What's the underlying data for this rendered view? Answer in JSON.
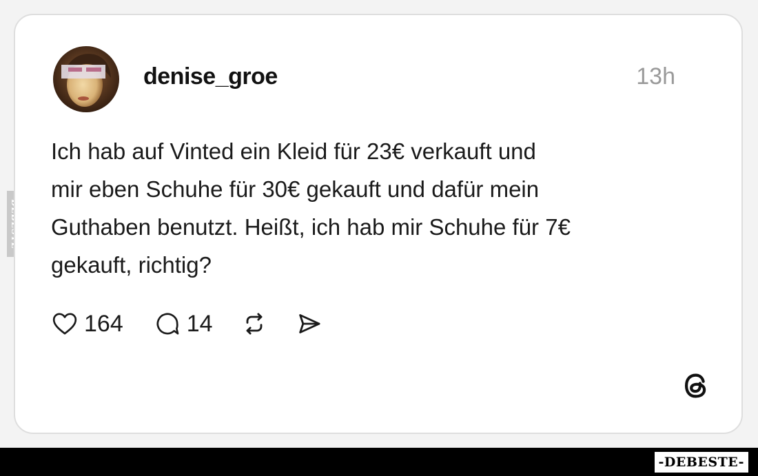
{
  "post": {
    "username": "denise_groe",
    "timestamp": "13h",
    "text_lines": [
      "Ich hab auf Vinted ein Kleid für 23€ verkauft und",
      "mir eben Schuhe für 30€ gekauft und dafür mein",
      "Guthaben benutzt. Heißt, ich hab mir Schuhe für 7€",
      "gekauft, richtig?"
    ],
    "likes": "164",
    "replies": "14"
  },
  "icons": {
    "avatar": "profile-photo",
    "like": "heart-icon",
    "reply": "speech-bubble-icon",
    "repost": "repost-arrows-icon",
    "share": "send-icon",
    "brand": "threads-logo"
  },
  "watermark": {
    "side": "DEBESTE",
    "bottom": "-DEBESTE-"
  },
  "colors": {
    "text": "#1a1a1a",
    "muted": "#9a9a9a",
    "card": "#ffffff",
    "border": "#dedede",
    "bar": "#000000"
  }
}
